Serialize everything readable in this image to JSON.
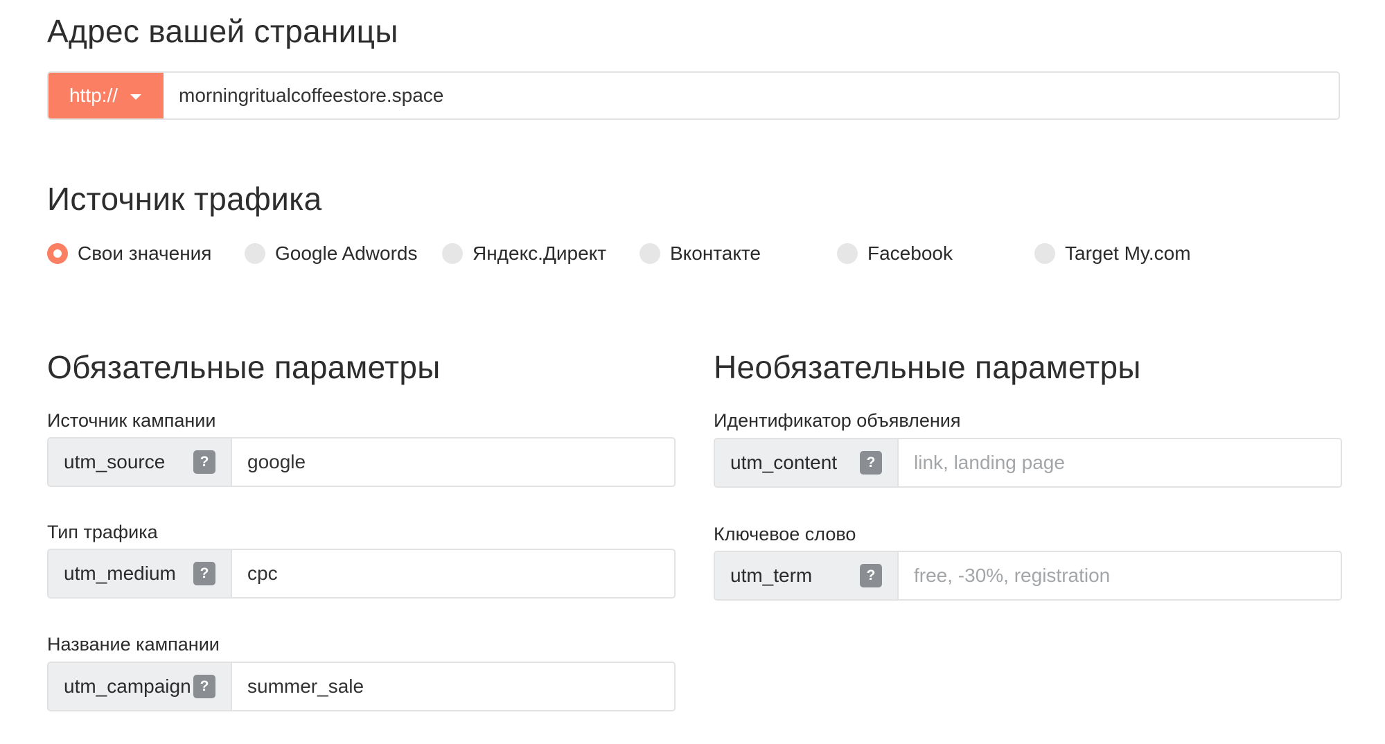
{
  "address": {
    "title": "Адрес вашей страницы",
    "protocol": "http://",
    "url": "morningritualcoffeestore.space"
  },
  "traffic": {
    "title": "Источник трафика",
    "options": [
      {
        "label": "Свои значения",
        "selected": true
      },
      {
        "label": "Google Adwords",
        "selected": false
      },
      {
        "label": "Яндекс.Директ",
        "selected": false
      },
      {
        "label": "Вконтакте",
        "selected": false
      },
      {
        "label": "Facebook",
        "selected": false
      },
      {
        "label": "Target My.com",
        "selected": false
      }
    ]
  },
  "required": {
    "title": "Обязательные параметры",
    "fields": [
      {
        "label": "Источник кампании",
        "key": "utm_source",
        "value": "google",
        "placeholder": ""
      },
      {
        "label": "Тип трафика",
        "key": "utm_medium",
        "value": "cpc",
        "placeholder": ""
      },
      {
        "label": "Название кампании",
        "key": "utm_campaign",
        "value": "summer_sale",
        "placeholder": ""
      }
    ]
  },
  "optional": {
    "title": "Необязательные параметры",
    "fields": [
      {
        "label": "Идентификатор объявления",
        "key": "utm_content",
        "value": "",
        "placeholder": "link, landing page"
      },
      {
        "label": "Ключевое слово",
        "key": "utm_term",
        "value": "",
        "placeholder": "free, -30%, registration"
      }
    ]
  },
  "help_symbol": "?",
  "colors": {
    "accent": "#fb7f63",
    "key_bg": "#eceeef",
    "help_bg": "#8a8d91",
    "border": "#e2e2e2"
  }
}
